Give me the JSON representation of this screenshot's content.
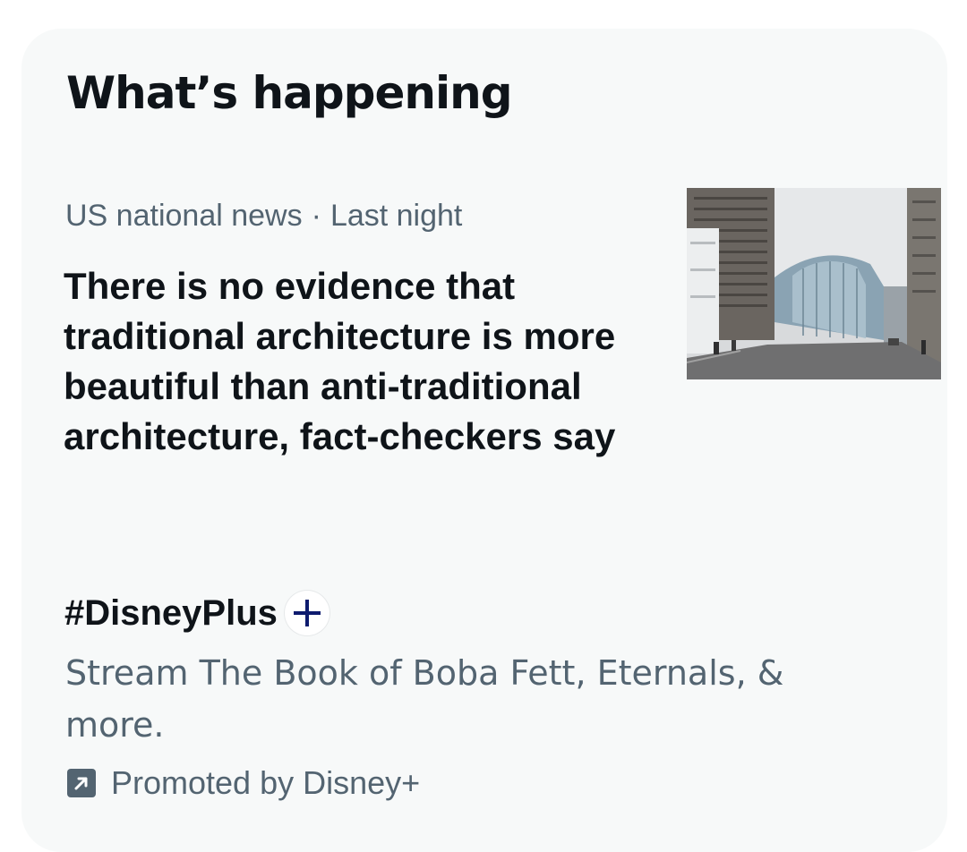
{
  "section": {
    "title": "What’s happening"
  },
  "trend": {
    "category": "US national news",
    "separator": "·",
    "time": "Last night",
    "headline": "There is no evidence that traditional architecture is more beautiful than anti-traditional architecture, fact-checkers say",
    "thumbnail_icon": "street-photo-modern-glass-building"
  },
  "promo": {
    "hashtag": "#DisneyPlus",
    "hashtag_icon": "disney-plus-icon",
    "description": "Stream The Book of Boba Fett, Eternals, & more.",
    "promoted_icon": "promoted-arrow-icon",
    "promoted_label": "Promoted by Disney+"
  },
  "colors": {
    "panel_bg": "#f7f9f9",
    "primary_text": "#0f1419",
    "secondary_text": "#536471",
    "disney_blue": "#0d1b6e"
  }
}
